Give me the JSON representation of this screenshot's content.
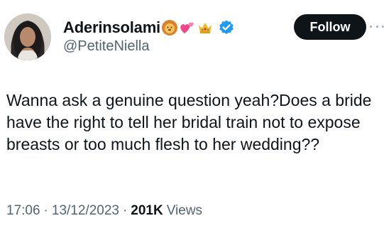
{
  "tweet": {
    "author": {
      "display_name": "Aderinsolami",
      "handle": "@PetiteNiella",
      "name_emojis": [
        "lion-face-icon",
        "two-hearts-icon",
        "crown-icon"
      ],
      "verified": true,
      "verified_icon": "verified-badge-icon",
      "verified_color": "#1d9bf0"
    },
    "follow_label": "Follow",
    "more_icon": "more-options-icon",
    "text": "Wanna ask a genuine question yeah?Does a bride have the right to tell her bridal train not to expose breasts or too much flesh to her wedding??",
    "time": "17:06",
    "separator": "·",
    "date": "13/12/2023",
    "views_count": "201K",
    "views_label": "Views"
  },
  "colors": {
    "text_primary": "#0f1419",
    "text_secondary": "#536471",
    "follow_bg": "#0f1419",
    "follow_text": "#ffffff",
    "background": "#ffffff"
  }
}
